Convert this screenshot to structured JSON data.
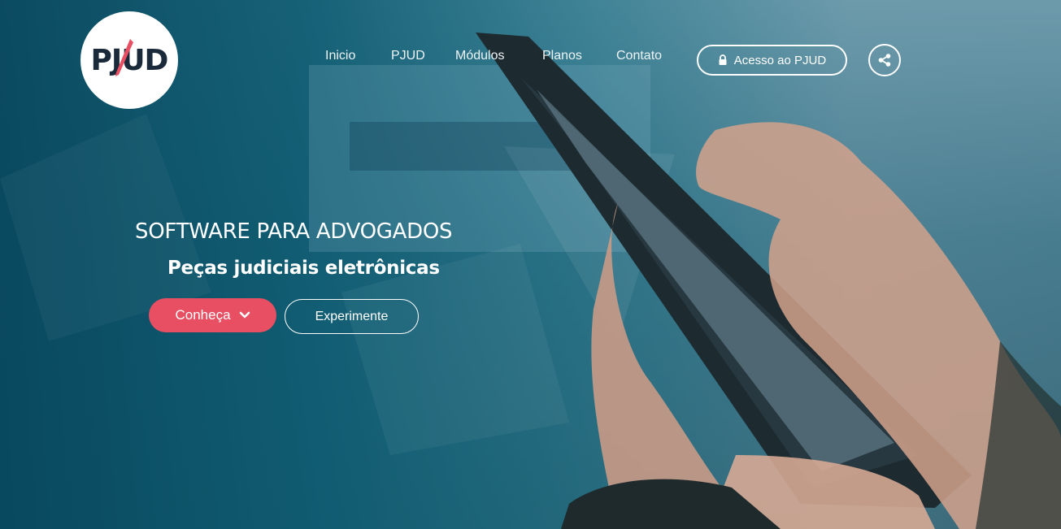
{
  "logo": {
    "text": "PJUD",
    "accent_color": "#e84f62"
  },
  "nav": {
    "items": [
      {
        "label": "Inicio"
      },
      {
        "label": "PJUD"
      },
      {
        "label": "Módulos"
      },
      {
        "label": "Planos"
      },
      {
        "label": "Contato"
      }
    ],
    "access_label": "Acesso ao PJUD",
    "access_icon": "lock-icon",
    "share_icon": "share-icon"
  },
  "hero": {
    "title": "SOFTWARE PARA ADVOGADOS",
    "subtitle": "Peças judiciais eletrônicas",
    "primary_button": "Conheça",
    "primary_button_icon": "chevron-down-icon",
    "primary_color": "#e84f62",
    "secondary_button": "Experimente",
    "background_image": "hands-holding-tablet"
  }
}
